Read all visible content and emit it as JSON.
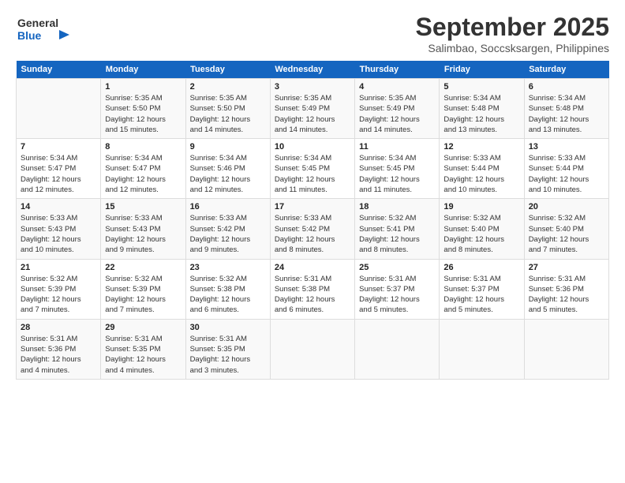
{
  "header": {
    "logo_line1": "General",
    "logo_line2": "Blue",
    "title": "September 2025",
    "subtitle": "Salimbao, Soccsksargen, Philippines"
  },
  "days_of_week": [
    "Sunday",
    "Monday",
    "Tuesday",
    "Wednesday",
    "Thursday",
    "Friday",
    "Saturday"
  ],
  "weeks": [
    [
      {
        "day": "",
        "info": ""
      },
      {
        "day": "1",
        "info": "Sunrise: 5:35 AM\nSunset: 5:50 PM\nDaylight: 12 hours\nand 15 minutes."
      },
      {
        "day": "2",
        "info": "Sunrise: 5:35 AM\nSunset: 5:50 PM\nDaylight: 12 hours\nand 14 minutes."
      },
      {
        "day": "3",
        "info": "Sunrise: 5:35 AM\nSunset: 5:49 PM\nDaylight: 12 hours\nand 14 minutes."
      },
      {
        "day": "4",
        "info": "Sunrise: 5:35 AM\nSunset: 5:49 PM\nDaylight: 12 hours\nand 14 minutes."
      },
      {
        "day": "5",
        "info": "Sunrise: 5:34 AM\nSunset: 5:48 PM\nDaylight: 12 hours\nand 13 minutes."
      },
      {
        "day": "6",
        "info": "Sunrise: 5:34 AM\nSunset: 5:48 PM\nDaylight: 12 hours\nand 13 minutes."
      }
    ],
    [
      {
        "day": "7",
        "info": "Sunrise: 5:34 AM\nSunset: 5:47 PM\nDaylight: 12 hours\nand 12 minutes."
      },
      {
        "day": "8",
        "info": "Sunrise: 5:34 AM\nSunset: 5:47 PM\nDaylight: 12 hours\nand 12 minutes."
      },
      {
        "day": "9",
        "info": "Sunrise: 5:34 AM\nSunset: 5:46 PM\nDaylight: 12 hours\nand 12 minutes."
      },
      {
        "day": "10",
        "info": "Sunrise: 5:34 AM\nSunset: 5:45 PM\nDaylight: 12 hours\nand 11 minutes."
      },
      {
        "day": "11",
        "info": "Sunrise: 5:34 AM\nSunset: 5:45 PM\nDaylight: 12 hours\nand 11 minutes."
      },
      {
        "day": "12",
        "info": "Sunrise: 5:33 AM\nSunset: 5:44 PM\nDaylight: 12 hours\nand 10 minutes."
      },
      {
        "day": "13",
        "info": "Sunrise: 5:33 AM\nSunset: 5:44 PM\nDaylight: 12 hours\nand 10 minutes."
      }
    ],
    [
      {
        "day": "14",
        "info": "Sunrise: 5:33 AM\nSunset: 5:43 PM\nDaylight: 12 hours\nand 10 minutes."
      },
      {
        "day": "15",
        "info": "Sunrise: 5:33 AM\nSunset: 5:43 PM\nDaylight: 12 hours\nand 9 minutes."
      },
      {
        "day": "16",
        "info": "Sunrise: 5:33 AM\nSunset: 5:42 PM\nDaylight: 12 hours\nand 9 minutes."
      },
      {
        "day": "17",
        "info": "Sunrise: 5:33 AM\nSunset: 5:42 PM\nDaylight: 12 hours\nand 8 minutes."
      },
      {
        "day": "18",
        "info": "Sunrise: 5:32 AM\nSunset: 5:41 PM\nDaylight: 12 hours\nand 8 minutes."
      },
      {
        "day": "19",
        "info": "Sunrise: 5:32 AM\nSunset: 5:40 PM\nDaylight: 12 hours\nand 8 minutes."
      },
      {
        "day": "20",
        "info": "Sunrise: 5:32 AM\nSunset: 5:40 PM\nDaylight: 12 hours\nand 7 minutes."
      }
    ],
    [
      {
        "day": "21",
        "info": "Sunrise: 5:32 AM\nSunset: 5:39 PM\nDaylight: 12 hours\nand 7 minutes."
      },
      {
        "day": "22",
        "info": "Sunrise: 5:32 AM\nSunset: 5:39 PM\nDaylight: 12 hours\nand 7 minutes."
      },
      {
        "day": "23",
        "info": "Sunrise: 5:32 AM\nSunset: 5:38 PM\nDaylight: 12 hours\nand 6 minutes."
      },
      {
        "day": "24",
        "info": "Sunrise: 5:31 AM\nSunset: 5:38 PM\nDaylight: 12 hours\nand 6 minutes."
      },
      {
        "day": "25",
        "info": "Sunrise: 5:31 AM\nSunset: 5:37 PM\nDaylight: 12 hours\nand 5 minutes."
      },
      {
        "day": "26",
        "info": "Sunrise: 5:31 AM\nSunset: 5:37 PM\nDaylight: 12 hours\nand 5 minutes."
      },
      {
        "day": "27",
        "info": "Sunrise: 5:31 AM\nSunset: 5:36 PM\nDaylight: 12 hours\nand 5 minutes."
      }
    ],
    [
      {
        "day": "28",
        "info": "Sunrise: 5:31 AM\nSunset: 5:36 PM\nDaylight: 12 hours\nand 4 minutes."
      },
      {
        "day": "29",
        "info": "Sunrise: 5:31 AM\nSunset: 5:35 PM\nDaylight: 12 hours\nand 4 minutes."
      },
      {
        "day": "30",
        "info": "Sunrise: 5:31 AM\nSunset: 5:35 PM\nDaylight: 12 hours\nand 3 minutes."
      },
      {
        "day": "",
        "info": ""
      },
      {
        "day": "",
        "info": ""
      },
      {
        "day": "",
        "info": ""
      },
      {
        "day": "",
        "info": ""
      }
    ]
  ]
}
